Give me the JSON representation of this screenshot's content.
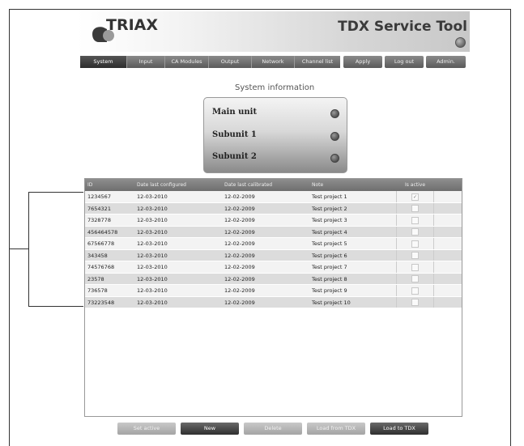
{
  "header": {
    "logo_text": "TRIAX",
    "app_title": "TDX Service Tool"
  },
  "nav": {
    "tabs": [
      {
        "label": "System",
        "active": true
      },
      {
        "label": "Input",
        "active": false
      },
      {
        "label": "CA Modules",
        "active": false
      },
      {
        "label": "Output",
        "active": false
      },
      {
        "label": "Network",
        "active": false
      },
      {
        "label": "Channel list",
        "active": false
      }
    ],
    "actions": [
      {
        "label": "Apply"
      },
      {
        "label": "Log out"
      },
      {
        "label": "Admin."
      }
    ]
  },
  "system": {
    "title": "System information",
    "units": [
      {
        "label": "Main unit"
      },
      {
        "label": "Subunit 1"
      },
      {
        "label": "Subunit 2"
      }
    ]
  },
  "table": {
    "columns": [
      "ID",
      "Date last configured",
      "Date last calibrated",
      "Note",
      "Is active"
    ],
    "rows": [
      {
        "id": "1234567",
        "configured": "12-03-2010",
        "calibrated": "12-02-2009",
        "note": "Test project 1",
        "active": true
      },
      {
        "id": "7654321",
        "configured": "12-03-2010",
        "calibrated": "12-02-2009",
        "note": "Test project 2",
        "active": false
      },
      {
        "id": "7328778",
        "configured": "12-03-2010",
        "calibrated": "12-02-2009",
        "note": "Test project 3",
        "active": false
      },
      {
        "id": "456464578",
        "configured": "12-03-2010",
        "calibrated": "12-02-2009",
        "note": "Test project 4",
        "active": false
      },
      {
        "id": "67566778",
        "configured": "12-03-2010",
        "calibrated": "12-02-2009",
        "note": "Test project 5",
        "active": false
      },
      {
        "id": "343458",
        "configured": "12-03-2010",
        "calibrated": "12-02-2009",
        "note": "Test project 6",
        "active": false
      },
      {
        "id": "74576768",
        "configured": "12-03-2010",
        "calibrated": "12-02-2009",
        "note": "Test project 7",
        "active": false
      },
      {
        "id": "23578",
        "configured": "12-03-2010",
        "calibrated": "12-02-2009",
        "note": "Test project 8",
        "active": false
      },
      {
        "id": "736578",
        "configured": "12-03-2010",
        "calibrated": "12-02-2009",
        "note": "Test project 9",
        "active": false
      },
      {
        "id": "73223548",
        "configured": "12-03-2010",
        "calibrated": "12-02-2009",
        "note": "Test project 10",
        "active": false
      }
    ]
  },
  "buttons": [
    {
      "label": "Set active",
      "enabled": false
    },
    {
      "label": "New",
      "enabled": true
    },
    {
      "label": "Delete",
      "enabled": false
    },
    {
      "label": "Load from TDX",
      "enabled": false
    },
    {
      "label": "Load to TDX",
      "enabled": true
    }
  ]
}
